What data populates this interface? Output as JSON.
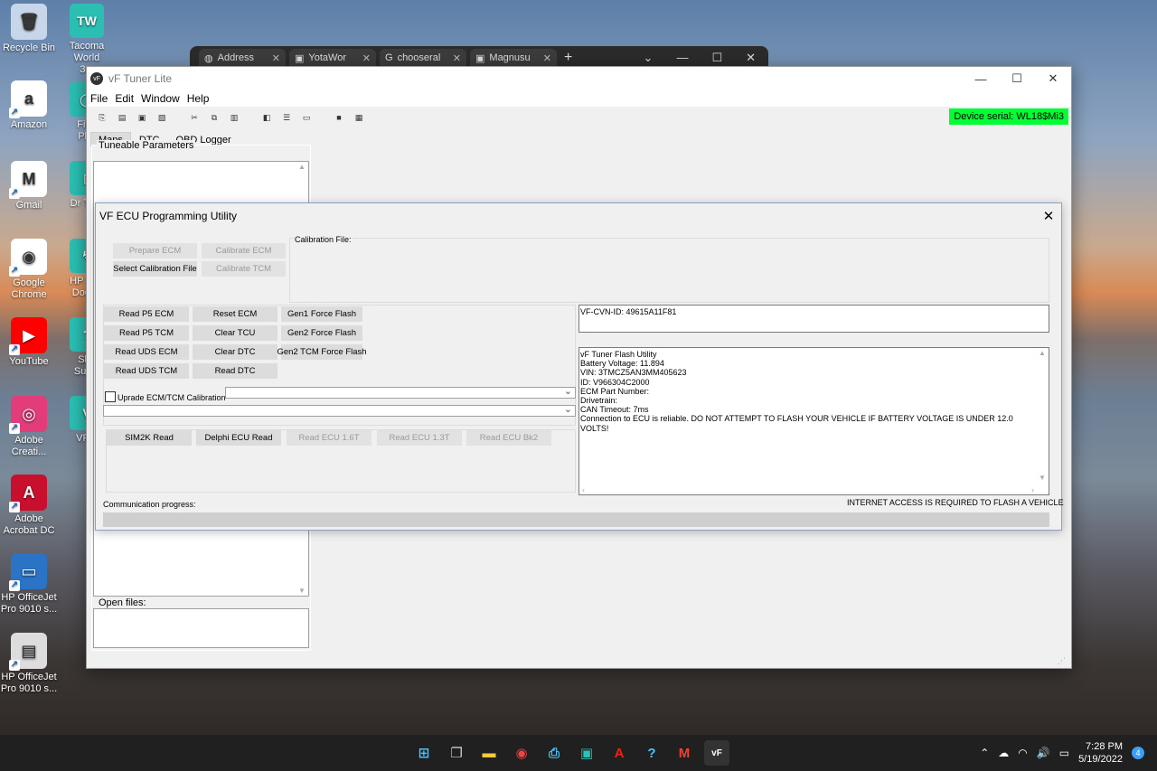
{
  "desktop": {
    "icons": [
      {
        "label": "Recycle Bin",
        "glyph": "🗑",
        "color": "#c7d6e8"
      },
      {
        "label": "Amazon",
        "glyph": "a",
        "color": "#ffffff"
      },
      {
        "label": "Gmail",
        "glyph": "M",
        "color": "#ffffff"
      },
      {
        "label": "Google Chrome",
        "glyph": "◉",
        "color": "#ffffff"
      },
      {
        "label": "YouTube",
        "glyph": "▶",
        "color": "#ff0000"
      },
      {
        "label": "Adobe Creati...",
        "glyph": "◎",
        "color": "#e23c7b"
      },
      {
        "label": "Adobe Acrobat DC",
        "glyph": "A",
        "color": "#c8102e"
      },
      {
        "label": "HP OfficeJet Pro 9010 s...",
        "glyph": "▭",
        "color": "#2b73c5"
      },
      {
        "label": "HP OfficeJet Pro 9010 s...",
        "glyph": "▤",
        "color": "#dddddd"
      }
    ],
    "partial_icons": [
      {
        "label": "Tacoma World 3...",
        "glyph": "TW"
      },
      {
        "label": "Find Phe",
        "glyph": "◯"
      },
      {
        "label": "Dr Tran",
        "glyph": "▯"
      },
      {
        "label": "HP Prin Doctor",
        "glyph": "↯"
      },
      {
        "label": "Sho Suppl",
        "glyph": "?"
      },
      {
        "label": "VF T",
        "glyph": "V"
      }
    ]
  },
  "bg_browser": {
    "tabs": [
      "Address",
      "YotaWor",
      "chooseral",
      "Magnusu"
    ]
  },
  "main_window": {
    "title": "vF Tuner Lite",
    "logo": "vF",
    "menu": [
      "File",
      "Edit",
      "Window",
      "Help"
    ],
    "device_serial": "Device serial: WL18$Mi3",
    "tabs": [
      "Maps",
      "DTC",
      "OBD Logger"
    ],
    "tuneable_label": "Tuneable Parameters",
    "open_files_label": "Open files:"
  },
  "dialog": {
    "title": "VF ECU Programming Utility",
    "calibration_file_label": "Calibration File:",
    "btn_prepare_ecm": "Prepare ECM",
    "btn_calibrate_ecm": "Calibrate ECM",
    "btn_select_calibration": "Select Calibration File",
    "btn_calibrate_tcm": "Calibrate TCM",
    "btn_read_p5_ecm": "Read P5 ECM",
    "btn_reset_ecm": "Reset ECM",
    "btn_gen1_force": "Gen1 Force Flash",
    "btn_read_p5_tcm": "Read P5 TCM",
    "btn_clear_tcu": "Clear TCU",
    "btn_gen2_force": "Gen2 Force Flash",
    "btn_read_uds_ecm": "Read UDS ECM",
    "btn_clear_dtc": "Clear DTC",
    "btn_gen2_tcm_force": "Gen2 TCM Force Flash",
    "btn_read_uds_tcm": "Read UDS TCM",
    "btn_read_dtc": "Read DTC",
    "upgrade_label": "Uprade ECM/TCM Calibration",
    "btn_sim2k": "SIM2K Read",
    "btn_delphi": "Delphi ECU Read",
    "btn_read_16t": "Read ECU 1.6T",
    "btn_read_13t": "Read ECU 1.3T",
    "btn_read_bk2": "Read ECU Bk2",
    "cvn_text": "VF-CVN-ID: 49615A11F81",
    "log_lines": [
      "vF Tuner Flash Utility",
      "Battery Voltage: 11.894",
      "VIN: 3TMCZ5AN3MM405623",
      "ID: V966304C2000",
      "ECM Part Number:",
      "Drivetrain:",
      "CAN Timeout: 7ms",
      "Connection to ECU is reliable. DO NOT ATTEMPT TO FLASH YOUR VEHICLE IF BATTERY VOLTAGE IS UNDER 12.0 VOLTS!"
    ],
    "comm_progress_label": "Communication progress:",
    "internet_notice": "INTERNET ACCESS IS REQUIRED TO FLASH A VEHICLE",
    "progress": 0
  },
  "taskbar": {
    "time": "7:28 PM",
    "date": "5/19/2022",
    "notifications": "4"
  }
}
